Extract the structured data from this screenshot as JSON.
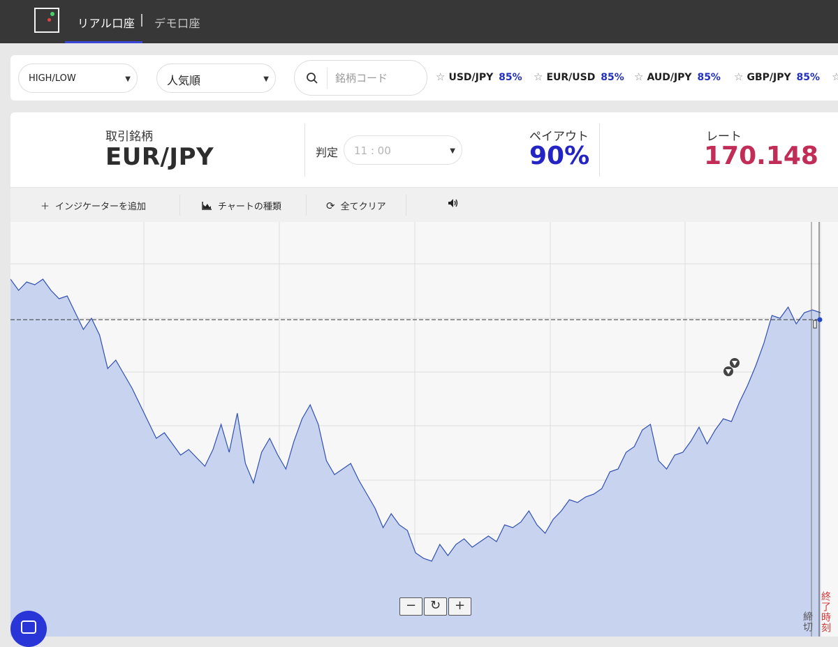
{
  "topbar": {
    "tabs": [
      {
        "label": "リアル口座",
        "active": true
      },
      {
        "label": "デモ口座",
        "active": false
      }
    ],
    "accent_color": "#3a47d5"
  },
  "filters": {
    "trade_type": "HIGH/LOW",
    "sort_order": "人気順",
    "search_placeholder": "銘柄コード",
    "favorites": [
      {
        "symbol": "USD/JPY",
        "payout": "85%"
      },
      {
        "symbol": "EUR/USD",
        "payout": "85%"
      },
      {
        "symbol": "AUD/JPY",
        "payout": "85%"
      },
      {
        "symbol": "GBP/JPY",
        "payout": "85%"
      }
    ]
  },
  "info": {
    "asset_label": "取引銘柄",
    "asset": "EUR/JPY",
    "expiry_label": "判定",
    "expiry_time": "11 : 00",
    "payout_label": "ペイアウト",
    "payout": "90%",
    "rate_label": "レート",
    "rate": "170.148",
    "payout_color": "#2424c4",
    "rate_color": "#c22d57"
  },
  "toolbar": {
    "add_indicator": "インジケーターを追加",
    "chart_type": "チャートの種類",
    "clear_all": "全てクリア"
  },
  "chart_data": {
    "type": "area",
    "current_rate": 170.148,
    "line_color": "#3050b0",
    "fill_color": "#c8d3f0",
    "price_path_normalized": [
      [
        0.0,
        0.92
      ],
      [
        0.01,
        0.88
      ],
      [
        0.02,
        0.91
      ],
      [
        0.03,
        0.9
      ],
      [
        0.04,
        0.92
      ],
      [
        0.05,
        0.88
      ],
      [
        0.06,
        0.85
      ],
      [
        0.07,
        0.86
      ],
      [
        0.08,
        0.8
      ],
      [
        0.09,
        0.74
      ],
      [
        0.1,
        0.78
      ],
      [
        0.11,
        0.72
      ],
      [
        0.12,
        0.6
      ],
      [
        0.13,
        0.63
      ],
      [
        0.14,
        0.58
      ],
      [
        0.15,
        0.53
      ],
      [
        0.16,
        0.47
      ],
      [
        0.17,
        0.41
      ],
      [
        0.18,
        0.35
      ],
      [
        0.19,
        0.37
      ],
      [
        0.2,
        0.33
      ],
      [
        0.21,
        0.29
      ],
      [
        0.22,
        0.31
      ],
      [
        0.23,
        0.28
      ],
      [
        0.24,
        0.25
      ],
      [
        0.25,
        0.31
      ],
      [
        0.26,
        0.4
      ],
      [
        0.27,
        0.3
      ],
      [
        0.28,
        0.44
      ],
      [
        0.29,
        0.26
      ],
      [
        0.3,
        0.19
      ],
      [
        0.31,
        0.3
      ],
      [
        0.32,
        0.35
      ],
      [
        0.33,
        0.29
      ],
      [
        0.34,
        0.24
      ],
      [
        0.35,
        0.34
      ],
      [
        0.36,
        0.42
      ],
      [
        0.37,
        0.47
      ],
      [
        0.38,
        0.4
      ],
      [
        0.39,
        0.27
      ],
      [
        0.4,
        0.22
      ],
      [
        0.41,
        0.24
      ],
      [
        0.42,
        0.26
      ],
      [
        0.43,
        0.2
      ],
      [
        0.44,
        0.15
      ],
      [
        0.45,
        0.1
      ],
      [
        0.46,
        0.03
      ],
      [
        0.47,
        0.08
      ],
      [
        0.48,
        0.04
      ],
      [
        0.49,
        0.02
      ],
      [
        0.5,
        -0.06
      ],
      [
        0.51,
        -0.08
      ],
      [
        0.52,
        -0.09
      ],
      [
        0.53,
        -0.03
      ],
      [
        0.54,
        -0.07
      ],
      [
        0.55,
        -0.03
      ],
      [
        0.56,
        -0.01
      ],
      [
        0.57,
        -0.04
      ],
      [
        0.58,
        -0.02
      ],
      [
        0.59,
        0.0
      ],
      [
        0.6,
        -0.02
      ],
      [
        0.61,
        0.04
      ],
      [
        0.62,
        0.03
      ],
      [
        0.63,
        0.05
      ],
      [
        0.64,
        0.09
      ],
      [
        0.65,
        0.04
      ],
      [
        0.66,
        0.01
      ],
      [
        0.67,
        0.06
      ],
      [
        0.68,
        0.09
      ],
      [
        0.69,
        0.13
      ],
      [
        0.7,
        0.12
      ],
      [
        0.71,
        0.14
      ],
      [
        0.72,
        0.15
      ],
      [
        0.73,
        0.17
      ],
      [
        0.74,
        0.23
      ],
      [
        0.75,
        0.24
      ],
      [
        0.76,
        0.3
      ],
      [
        0.77,
        0.32
      ],
      [
        0.78,
        0.38
      ],
      [
        0.79,
        0.4
      ],
      [
        0.8,
        0.27
      ],
      [
        0.81,
        0.24
      ],
      [
        0.82,
        0.29
      ],
      [
        0.83,
        0.3
      ],
      [
        0.84,
        0.34
      ],
      [
        0.85,
        0.39
      ],
      [
        0.86,
        0.33
      ],
      [
        0.87,
        0.38
      ],
      [
        0.88,
        0.42
      ],
      [
        0.89,
        0.41
      ],
      [
        0.9,
        0.48
      ],
      [
        0.91,
        0.54
      ],
      [
        0.92,
        0.61
      ],
      [
        0.93,
        0.69
      ],
      [
        0.94,
        0.79
      ],
      [
        0.95,
        0.78
      ],
      [
        0.96,
        0.82
      ],
      [
        0.97,
        0.76
      ],
      [
        0.98,
        0.8
      ],
      [
        0.99,
        0.81
      ],
      [
        1.0,
        0.8
      ]
    ],
    "markers": [
      "high-entry",
      "low-entry"
    ],
    "end_labels": [
      "締切",
      "終了時刻"
    ]
  }
}
